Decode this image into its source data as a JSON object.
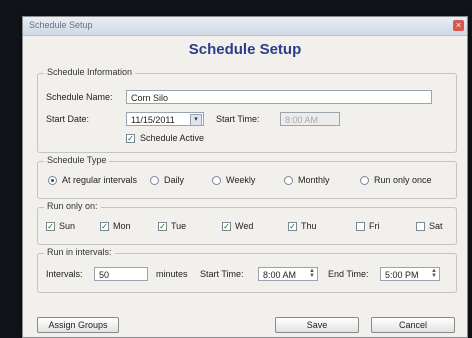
{
  "window": {
    "title": "Schedule Setup",
    "close_glyph": "×"
  },
  "heading": "Schedule Setup",
  "schedule_info": {
    "legend": "Schedule Information",
    "name_label": "Schedule Name:",
    "name_value": "Corn Silo",
    "start_date_label": "Start Date:",
    "start_date_value": "11/15/2011",
    "start_time_label": "Start Time:",
    "start_time_value": "8:00 AM",
    "active_label": "Schedule Active",
    "active_checked": true
  },
  "schedule_type": {
    "legend": "Schedule Type",
    "options": [
      "At regular intervals",
      "Daily",
      "Weekly",
      "Monthly",
      "Run only once"
    ],
    "selected": "At regular intervals"
  },
  "run_only_on": {
    "legend": "Run only on:",
    "days": [
      {
        "label": "Sun",
        "checked": true
      },
      {
        "label": "Mon",
        "checked": true
      },
      {
        "label": "Tue",
        "checked": true
      },
      {
        "label": "Wed",
        "checked": true
      },
      {
        "label": "Thu",
        "checked": true
      },
      {
        "label": "Fri",
        "checked": false
      },
      {
        "label": "Sat",
        "checked": false
      }
    ]
  },
  "intervals": {
    "legend": "Run in intervals:",
    "interval_label": "Intervals:",
    "interval_value": "50",
    "minutes_label": "minutes",
    "start_label": "Start Time:",
    "start_value": "8:00 AM",
    "end_label": "End Time:",
    "end_value": "5:00 PM"
  },
  "buttons": {
    "assign": "Assign Groups",
    "save": "Save",
    "cancel": "Cancel"
  },
  "icons": {
    "dropdown": "▾",
    "spin_up": "▲",
    "spin_down": "▼",
    "check": "✓"
  }
}
